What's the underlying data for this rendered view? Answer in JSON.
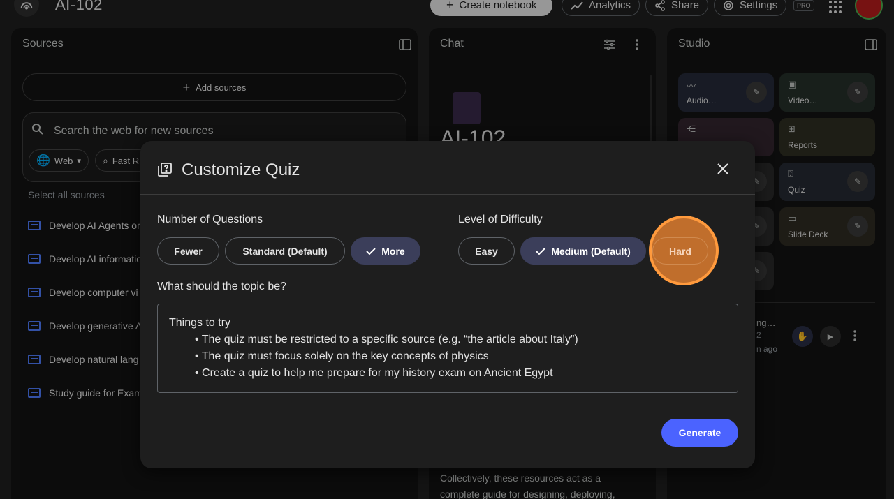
{
  "topbar": {
    "title": "AI-102",
    "create_label": "Create notebook",
    "analytics_label": "Analytics",
    "share_label": "Share",
    "settings_label": "Settings",
    "pro_label": "PRO"
  },
  "sources": {
    "header": "Sources",
    "add_label": "Add sources",
    "search_placeholder": "Search the web for new sources",
    "chip_web": "Web",
    "chip_fast": "Fast R",
    "select_all": "Select all sources",
    "items": [
      {
        "label": "Develop AI Agents on"
      },
      {
        "label": "Develop AI informatio"
      },
      {
        "label": "Develop computer vi"
      },
      {
        "label": "Develop generative A"
      },
      {
        "label": "Develop natural lang"
      },
      {
        "label": "Study guide for Exam"
      }
    ]
  },
  "chat": {
    "header": "Chat",
    "notebook_title": "AI-102",
    "bottom_text_1": "Collectively, these resources act as a",
    "bottom_text_2": "complete guide for designing, deploying,"
  },
  "studio": {
    "header": "Studio",
    "tiles": {
      "audio": "Audio…",
      "video": "Video…",
      "reports": "Reports",
      "quiz": "Quiz",
      "slide_deck": "Slide Deck"
    },
    "item_line1": "ng…",
    "item_line2": "2",
    "item_line3": "n ago"
  },
  "modal": {
    "title": "Customize Quiz",
    "questions_label": "Number of Questions",
    "questions_options": [
      "Fewer",
      "Standard (Default)",
      "More"
    ],
    "questions_selected": "More",
    "difficulty_label": "Level of Difficulty",
    "difficulty_options": [
      "Easy",
      "Medium (Default)",
      "Hard"
    ],
    "difficulty_selected": "Medium (Default)",
    "topic_label": "What should the topic be?",
    "topic_placeholder_head": "Things to try",
    "topic_placeholder_lines": [
      "• The quiz must be restricted to a specific source (e.g. “the article about Italy”)",
      "• The quiz must focus solely on the key concepts of physics",
      "• Create a quiz to help me prepare for my history exam on Ancient Egypt"
    ],
    "generate_label": "Generate"
  }
}
